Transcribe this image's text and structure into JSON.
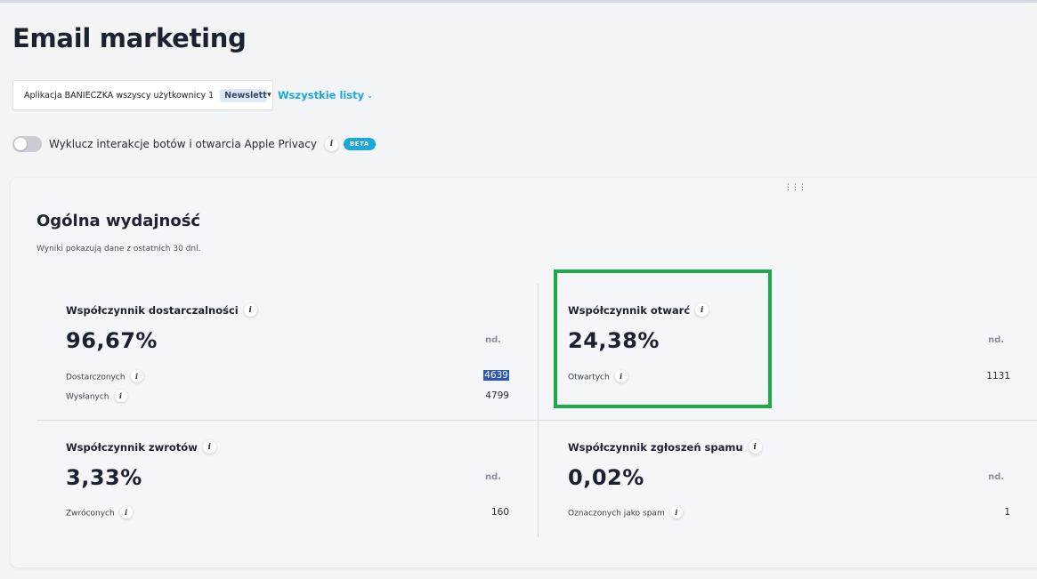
{
  "header": {
    "title": "Email marketing"
  },
  "filters": {
    "list_name": "Aplikacja BANIECZKA wszyscy użytkownicy 1",
    "list_chip": "Newsletter",
    "all_lists_label": "Wszystkie listy"
  },
  "toggle": {
    "label": "Wyklucz interakcje botów i otwarcia Apple Privacy",
    "enabled": false,
    "info_icon": "i",
    "badge": "BETA"
  },
  "card": {
    "title": "Ogólna wydajność",
    "subtitle": "Wyniki pokazują dane z ostatnich 30 dni.",
    "metrics": {
      "delivery": {
        "title": "Współczynnik dostarczalności",
        "value": "96,67%",
        "nd": "nd.",
        "rows": [
          {
            "label": "Dostarczonych",
            "value": "4639",
            "selected": true
          },
          {
            "label": "Wysłanych",
            "value": "4799"
          }
        ]
      },
      "open": {
        "title": "Współczynnik otwarć",
        "value": "24,38%",
        "nd": "nd.",
        "rows": [
          {
            "label": "Otwartych",
            "value": "1131"
          }
        ]
      },
      "bounce": {
        "title": "Współczynnik zwrotów",
        "value": "3,33%",
        "nd": "nd.",
        "rows": [
          {
            "label": "Zwróconych",
            "value": "160"
          }
        ]
      },
      "spam": {
        "title": "Współczynnik zgłoszeń spamu",
        "value": "0,02%",
        "nd": "nd.",
        "rows": [
          {
            "label": "Oznaczonych jako spam",
            "value": "1"
          }
        ]
      }
    }
  },
  "colors": {
    "accent_link": "#1aa9e0",
    "beta_badge": "#1aa7de",
    "highlight_box": "#1faa48",
    "selection": "#2f57b5"
  }
}
